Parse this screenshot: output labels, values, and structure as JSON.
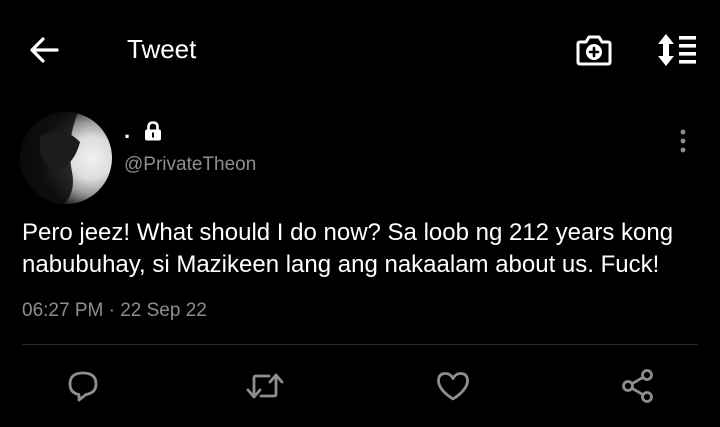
{
  "header": {
    "title": "Tweet",
    "back_icon": "arrow-left-icon",
    "camera_icon": "camera-plus-icon",
    "sort_icon": "sort-list-icon"
  },
  "tweet": {
    "display_name": ".",
    "protected_icon": "lock-icon",
    "handle": "@PrivateTheon",
    "text": "Pero jeez! What should I do now? Sa loob ng 212 years kong nabubuhay, si Mazikeen lang ang nakaalam about us. Fuck!",
    "meta": "06:27 PM · 22 Sep 22",
    "more_icon": "more-vertical-icon"
  },
  "actions": {
    "reply_icon": "reply-icon",
    "retweet_icon": "retweet-icon",
    "like_icon": "heart-icon",
    "share_icon": "share-icon"
  },
  "colors": {
    "background": "#000000",
    "primary_text": "#ffffff",
    "secondary_text": "#8e8e8e",
    "divider": "#2b2b2b",
    "icon": "#8e8e8e"
  }
}
